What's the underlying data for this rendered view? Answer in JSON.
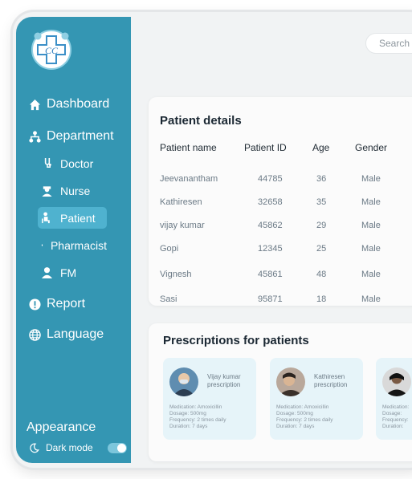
{
  "sidebar": {
    "nav": [
      {
        "label": "Dashboard",
        "icon": "home-icon"
      },
      {
        "label": "Department",
        "icon": "sitemap-icon"
      },
      {
        "label": "Report",
        "icon": "alert-circle-icon"
      },
      {
        "label": "Language",
        "icon": "globe-icon"
      }
    ],
    "sub": [
      {
        "label": "Doctor",
        "icon": "doctor-icon"
      },
      {
        "label": "Nurse",
        "icon": "nurse-icon"
      },
      {
        "label": "Patient",
        "icon": "patient-icon",
        "active": true
      },
      {
        "label": "Pharmacist",
        "icon": "pharmacist-icon"
      },
      {
        "label": "FM",
        "icon": "user-icon"
      }
    ],
    "appearance_label": "Appearance",
    "dark_mode_label": "Dark mode",
    "dark_mode_on": false
  },
  "search": {
    "placeholder": "Search"
  },
  "patients": {
    "title": "Patient details",
    "columns": [
      "Patient name",
      "Patient ID",
      "Age",
      "Gender"
    ],
    "rows": [
      [
        "Jeevanantham",
        "44785",
        "36",
        "Male"
      ],
      [
        "Kathiresen",
        "32658",
        "35",
        "Male"
      ],
      [
        "vijay kumar",
        "45862",
        "29",
        "Male"
      ],
      [
        "Gopi",
        "12345",
        "25",
        "Male"
      ],
      [
        "Vignesh",
        "45861",
        "48",
        "Male"
      ],
      [
        "Sasi",
        "95871",
        "18",
        "Male"
      ]
    ]
  },
  "prescriptions": {
    "title": "Prescriptions for patients",
    "cards": [
      {
        "name": "Vijay kumar prescription",
        "medication": "Medication: Amoxicillin",
        "dosage": "Dosage: 500mg",
        "frequency": "Frequency: 2 times daily",
        "duration": "Duration: 7 days"
      },
      {
        "name": "Kathiresen prescription",
        "medication": "Medication: Amoxicillin",
        "dosage": "Dosage: 500mg",
        "frequency": "Frequency: 2 times daily",
        "duration": "Duration: 7 days"
      },
      {
        "name": "",
        "medication": "Medication:",
        "dosage": "Dosage:",
        "frequency": "Frequency:",
        "duration": "Duration:"
      }
    ]
  },
  "colors": {
    "sidebar": "#3496b3",
    "active_item": "#4fb2cf",
    "card_bg": "#e6f4f9"
  }
}
